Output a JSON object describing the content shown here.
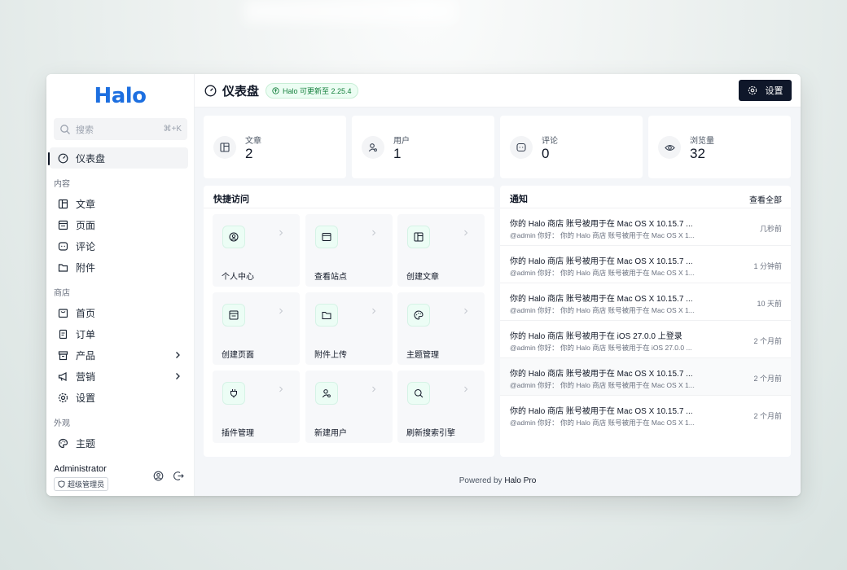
{
  "sidebar": {
    "logo": "Halo",
    "search": {
      "placeholder": "搜索",
      "shortcut": "⌘+K"
    },
    "dashboard": "仪表盘",
    "groups": {
      "content": "内容",
      "shop": "商店",
      "appearance": "外观"
    },
    "items": {
      "posts": "文章",
      "pages": "页面",
      "comments": "评论",
      "attachments": "附件",
      "home": "首页",
      "orders": "订单",
      "products": "产品",
      "marketing": "营销",
      "settings": "设置",
      "themes": "主题"
    },
    "user": {
      "name": "Administrator",
      "role": "超级管理员"
    }
  },
  "header": {
    "title": "仪表盘",
    "update_badge": "Halo 可更新至 2.25.4",
    "settings_button": "设置"
  },
  "stats": [
    {
      "label": "文章",
      "value": "2",
      "icon": "document-icon"
    },
    {
      "label": "用户",
      "value": "1",
      "icon": "user-icon"
    },
    {
      "label": "评论",
      "value": "0",
      "icon": "comment-icon"
    },
    {
      "label": "浏览量",
      "value": "32",
      "icon": "eye-icon"
    }
  ],
  "quick_access": {
    "title": "快捷访问",
    "tiles": [
      {
        "label": "个人中心",
        "icon": "user-circle-icon"
      },
      {
        "label": "查看站点",
        "icon": "browser-icon"
      },
      {
        "label": "创建文章",
        "icon": "document-icon"
      },
      {
        "label": "创建页面",
        "icon": "page-icon"
      },
      {
        "label": "附件上传",
        "icon": "folder-icon"
      },
      {
        "label": "主题管理",
        "icon": "palette-icon"
      },
      {
        "label": "插件管理",
        "icon": "plug-icon"
      },
      {
        "label": "新建用户",
        "icon": "user-add-icon"
      },
      {
        "label": "刷新搜索引擎",
        "icon": "search-icon"
      }
    ]
  },
  "notifications": {
    "title": "通知",
    "view_all": "查看全部",
    "items": [
      {
        "title": "你的 Halo 商店 账号被用于在 Mac OS X 10.15.7 ...",
        "subtitle": "@admin 你好： 你的 Halo 商店 账号被用于在 Mac OS X 1...",
        "time": "几秒前"
      },
      {
        "title": "你的 Halo 商店 账号被用于在 Mac OS X 10.15.7 ...",
        "subtitle": "@admin 你好： 你的 Halo 商店 账号被用于在 Mac OS X 1...",
        "time": "1 分钟前"
      },
      {
        "title": "你的 Halo 商店 账号被用于在 Mac OS X 10.15.7 ...",
        "subtitle": "@admin 你好： 你的 Halo 商店 账号被用于在 Mac OS X 1...",
        "time": "10 天前"
      },
      {
        "title": "你的 Halo 商店 账号被用于在 iOS 27.0.0 上登录",
        "subtitle": "@admin 你好： 你的 Halo 商店 账号被用于在 iOS 27.0.0 ...",
        "time": "2 个月前"
      },
      {
        "title": "你的 Halo 商店 账号被用于在 Mac OS X 10.15.7 ...",
        "subtitle": "@admin 你好： 你的 Halo 商店 账号被用于在 Mac OS X 1...",
        "time": "2 个月前"
      },
      {
        "title": "你的 Halo 商店 账号被用于在 Mac OS X 10.15.7 ...",
        "subtitle": "@admin 你好： 你的 Halo 商店 账号被用于在 Mac OS X 1...",
        "time": "2 个月前"
      }
    ]
  },
  "footer": {
    "prefix": "Powered by",
    "brand": "Halo Pro"
  },
  "colors": {
    "brand": "#1d6fe0",
    "accent_green": "#15803d",
    "dark_button": "#0f172a"
  }
}
